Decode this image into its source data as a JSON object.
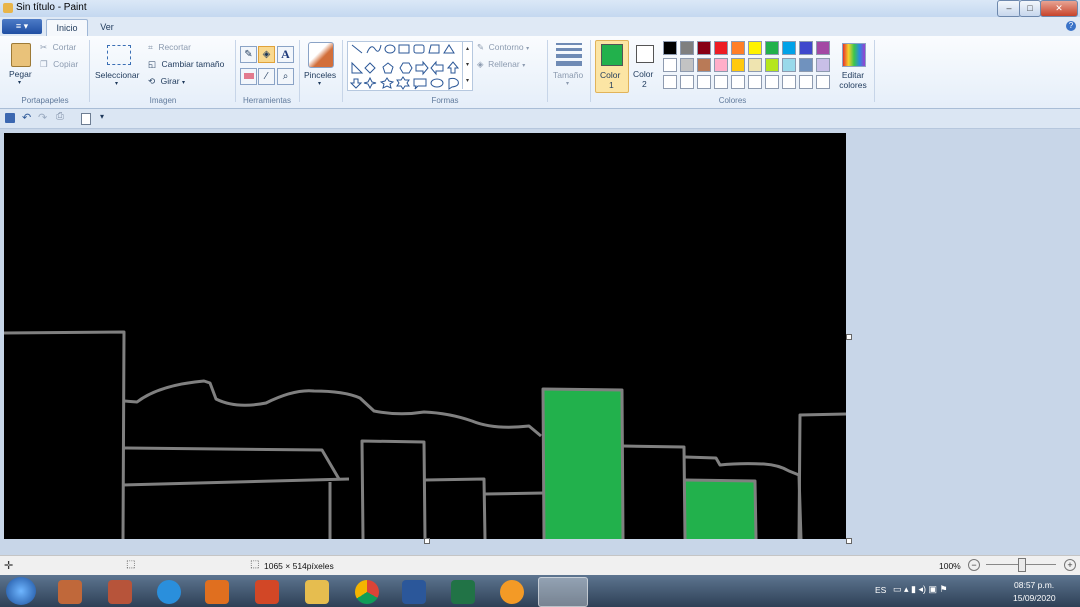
{
  "window": {
    "title": "Sin título - Paint"
  },
  "tabs": {
    "file_menu": "≡ ▾",
    "inicio": "Inicio",
    "ver": "Ver"
  },
  "ribbon": {
    "clipboard": {
      "pegar": "Pegar",
      "cortar": "Cortar",
      "copiar": "Copiar",
      "group": "Portapapeles"
    },
    "image": {
      "seleccionar": "Seleccionar",
      "recortar": "Recortar",
      "cambiar_tamano": "Cambiar tamaño",
      "girar": "Girar",
      "group": "Imagen"
    },
    "tools": {
      "group": "Herramientas",
      "text_tool": "A"
    },
    "brushes": {
      "label": "Pinceles"
    },
    "shapes": {
      "contorno": "Contorno",
      "rellenar": "Rellenar",
      "group": "Formas"
    },
    "size": {
      "label": "Tamaño"
    },
    "colors": {
      "color1": "Color",
      "color1_num": "1",
      "color2": "Color",
      "color2_num": "2",
      "editar": "Editar colores",
      "group": "Colores",
      "color1_value": "#22b14c",
      "color2_value": "#ffffff",
      "palette_row1": [
        "#000000",
        "#7f7f7f",
        "#880015",
        "#ed1c24",
        "#ff7f27",
        "#fff200",
        "#22b14c",
        "#00a2e8",
        "#3f48cc",
        "#a349a4"
      ],
      "palette_row2": [
        "#ffffff",
        "#c3c3c3",
        "#b97a57",
        "#ffaec9",
        "#ffc90e",
        "#efe4b0",
        "#b5e61d",
        "#99d9ea",
        "#7092be",
        "#c8bfe7"
      ]
    }
  },
  "canvas": {
    "background": "#000000",
    "stroke": "#808080",
    "fill": "#22b14c"
  },
  "statusbar": {
    "dimensions": "1065 × 514píxeles",
    "zoom": "100%"
  },
  "taskbar": {
    "language": "ES",
    "time": "08:57 p.m.",
    "date": "15/09/2020"
  }
}
